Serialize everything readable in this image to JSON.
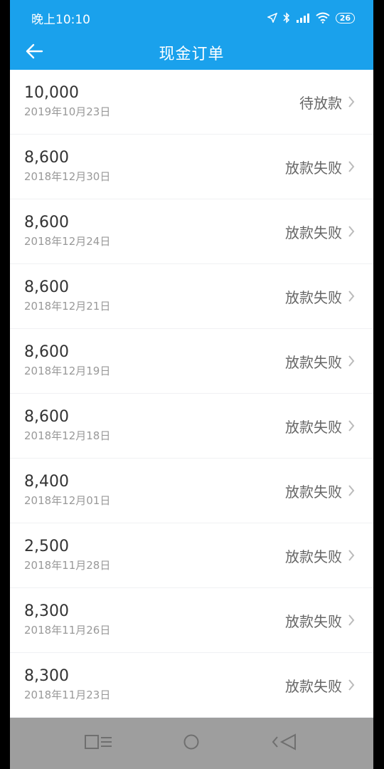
{
  "status_bar": {
    "time": "晚上10:10",
    "battery": "26"
  },
  "header": {
    "title": "现金订单"
  },
  "orders": [
    {
      "amount": "10,000",
      "date": "2019年10月23日",
      "status": "待放款"
    },
    {
      "amount": "8,600",
      "date": "2018年12月30日",
      "status": "放款失败"
    },
    {
      "amount": "8,600",
      "date": "2018年12月24日",
      "status": "放款失败"
    },
    {
      "amount": "8,600",
      "date": "2018年12月21日",
      "status": "放款失败"
    },
    {
      "amount": "8,600",
      "date": "2018年12月19日",
      "status": "放款失败"
    },
    {
      "amount": "8,600",
      "date": "2018年12月18日",
      "status": "放款失败"
    },
    {
      "amount": "8,400",
      "date": "2018年12月01日",
      "status": "放款失败"
    },
    {
      "amount": "2,500",
      "date": "2018年11月28日",
      "status": "放款失败"
    },
    {
      "amount": "8,300",
      "date": "2018年11月26日",
      "status": "放款失败"
    },
    {
      "amount": "8,300",
      "date": "2018年11月23日",
      "status": "放款失败"
    }
  ],
  "colors": {
    "accent": "#1aa1ec",
    "background": "#f0f1f3",
    "nav_bar": "#9e9e9e"
  },
  "icons": {
    "back": "arrow-left-icon",
    "row": "chevron-right-icon",
    "nav": [
      "menu-icon",
      "home-icon",
      "back-triangle-icon"
    ]
  }
}
